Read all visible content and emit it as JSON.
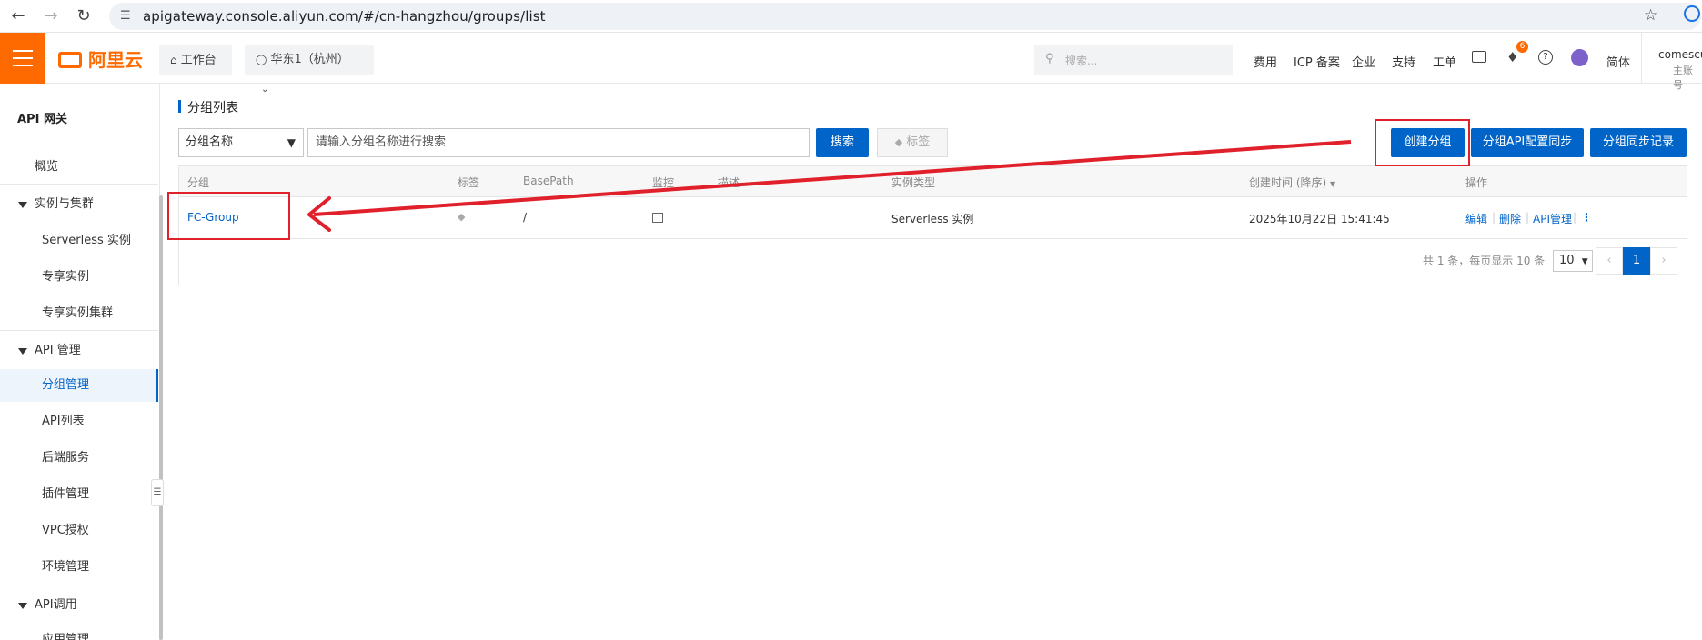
{
  "browser": {
    "url": "apigateway.console.aliyun.com/#/cn-hangzhou/groups/list",
    "back_icon": "arrow-left-icon",
    "forward_icon": "arrow-right-icon",
    "reload_icon": "reload-icon"
  },
  "header": {
    "logo_text": "阿里云",
    "workbench": "工作台",
    "region": "华东1（杭州）",
    "search_placeholder": "搜索...",
    "links": [
      "费用",
      "ICP 备案",
      "企业",
      "支持",
      "工单"
    ],
    "notification_count": "6",
    "language": "简体",
    "account_name": "comescui",
    "account_type": "主账号"
  },
  "sidebar": {
    "title": "API 网关",
    "overview": "概览",
    "groups": [
      {
        "label": "实例与集群",
        "items": [
          "Serverless 实例",
          "专享实例",
          "专享实例集群"
        ]
      },
      {
        "label": "API 管理",
        "items": [
          "分组管理",
          "API列表",
          "后端服务",
          "插件管理",
          "VPC授权",
          "环境管理"
        ]
      },
      {
        "label": "API调用",
        "items": [
          "应用管理"
        ]
      }
    ],
    "active_item": "分组管理"
  },
  "main": {
    "title": "分组列表",
    "filter_select": "分组名称",
    "search_placeholder": "请输入分组名称进行搜索",
    "search_button": "搜索",
    "tag_button": "标签",
    "create_button": "创建分组",
    "sync_config_button": "分组API配置同步",
    "sync_record_button": "分组同步记录",
    "columns": [
      "分组",
      "标签",
      "BasePath",
      "监控",
      "描述",
      "实例类型",
      "创建时间 (降序)",
      "操作"
    ],
    "rows": [
      {
        "group": "FC-Group",
        "basepath": "/",
        "instance_type": "Serverless 实例",
        "created": "2025年10月22日 15:41:45",
        "actions": [
          "编辑",
          "删除",
          "API管理"
        ]
      }
    ],
    "pagination": {
      "summary": "共 1 条，每页显示 10 条",
      "page_size": "10",
      "prev": "‹",
      "current": "1",
      "next": "›"
    }
  },
  "colors": {
    "accent": "#0064c8",
    "brand": "#ff6a00",
    "annotation": "#e0202a"
  }
}
